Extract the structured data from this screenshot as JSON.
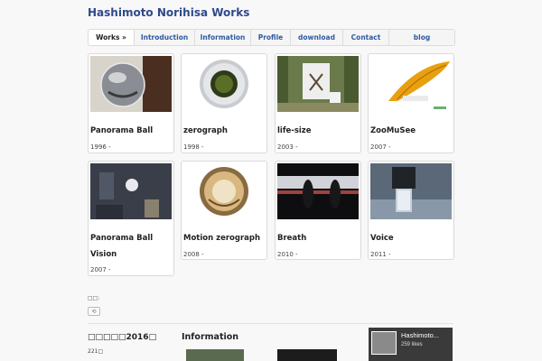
{
  "site": {
    "title": "Hashimoto Norihisa Works"
  },
  "nav": {
    "items": [
      {
        "label": "Works »"
      },
      {
        "label": "Introduction"
      },
      {
        "label": "Information"
      },
      {
        "label": "Profile"
      },
      {
        "label": "download"
      },
      {
        "label": "Contact"
      },
      {
        "label": "blog"
      }
    ]
  },
  "works": [
    {
      "title": "Panorama Ball",
      "year": "1996 -"
    },
    {
      "title": "zerograph",
      "year": "1998 -"
    },
    {
      "title": "life-size",
      "year": "2003 -"
    },
    {
      "title": "ZooMuSee",
      "year": "2007 -"
    },
    {
      "title": "Panorama Ball Vision",
      "year": "2007 -"
    },
    {
      "title": "Motion zerograph",
      "year": "2008 -"
    },
    {
      "title": "Breath",
      "year": "2010 -"
    },
    {
      "title": "Voice",
      "year": "2011 -"
    }
  ],
  "misc": {
    "small_text": "□□:",
    "small_button": "⟲"
  },
  "footer": {
    "heading": "□□□□□2016□",
    "sub": "221□",
    "info_heading": "Information"
  },
  "facebook": {
    "name": "Hashimoto...",
    "likes": "259 likes"
  },
  "colors": {
    "title": "#2e4a8c",
    "nav_link": "#2e5aa0"
  }
}
